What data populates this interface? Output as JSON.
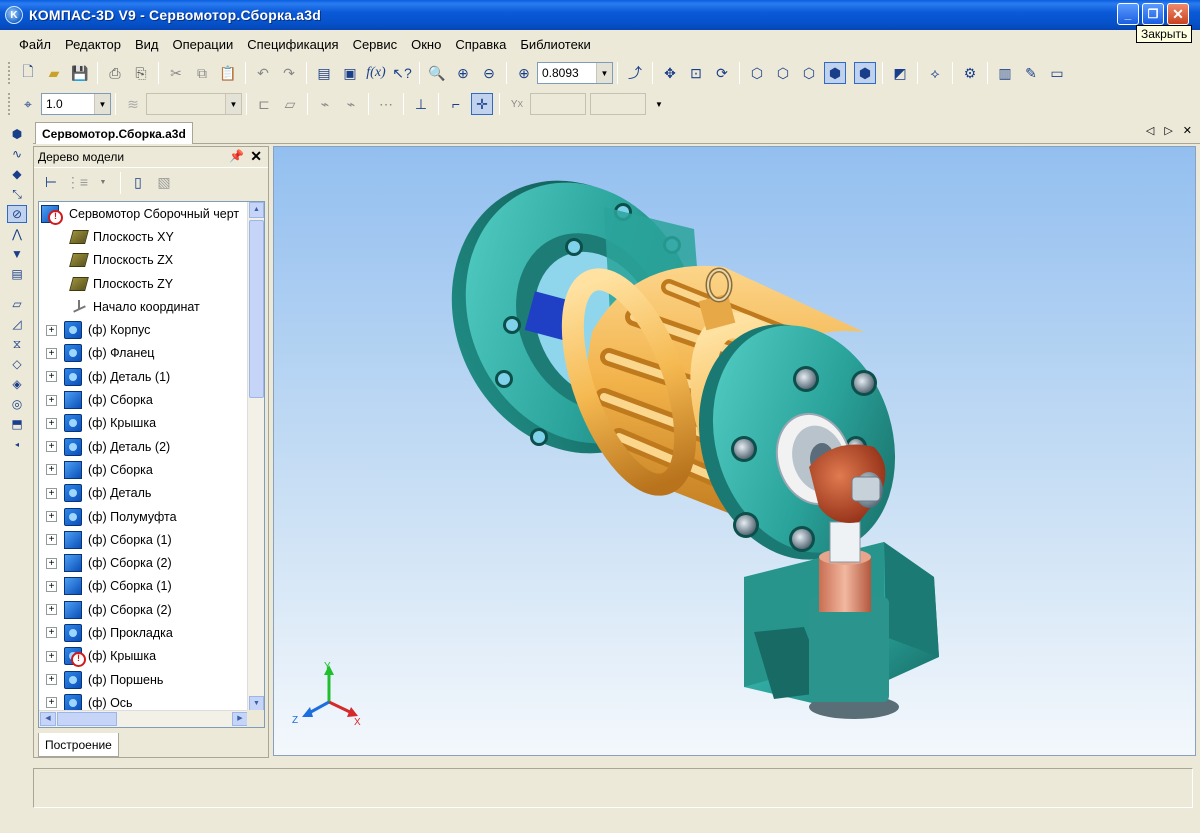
{
  "window": {
    "title": "КОМПАС-3D V9 - Сервомотор.Сборка.a3d",
    "close_tooltip": "Закрыть"
  },
  "menu": [
    "Файл",
    "Редактор",
    "Вид",
    "Операции",
    "Спецификация",
    "Сервис",
    "Окно",
    "Справка",
    "Библиотеки"
  ],
  "toolbar": {
    "zoom_value": "0.8093",
    "step_value": "1.0"
  },
  "document_tab": "Сервомотор.Сборка.a3d",
  "model_tree": {
    "panel_title": "Дерево модели",
    "root": "Сервомотор Сборочный черт",
    "items": [
      {
        "label": "Плоскость XY",
        "type": "plane",
        "expandable": false
      },
      {
        "label": "Плоскость ZX",
        "type": "plane",
        "expandable": false
      },
      {
        "label": "Плоскость ZY",
        "type": "plane",
        "expandable": false
      },
      {
        "label": "Начало координат",
        "type": "origin",
        "expandable": false
      },
      {
        "label": "(ф) Корпус",
        "type": "part",
        "expandable": true
      },
      {
        "label": "(ф) Фланец",
        "type": "part",
        "expandable": true
      },
      {
        "label": "(ф) Деталь (1)",
        "type": "part",
        "expandable": true
      },
      {
        "label": "(ф) Сборка",
        "type": "asm",
        "expandable": true
      },
      {
        "label": "(ф) Крышка",
        "type": "part",
        "expandable": true
      },
      {
        "label": "(ф) Деталь (2)",
        "type": "part",
        "expandable": true
      },
      {
        "label": "(ф) Сборка",
        "type": "asm",
        "expandable": true
      },
      {
        "label": "(ф) Деталь",
        "type": "part",
        "expandable": true
      },
      {
        "label": "(ф) Полумуфта",
        "type": "part",
        "expandable": true
      },
      {
        "label": "(ф) Сборка (1)",
        "type": "asm",
        "expandable": true
      },
      {
        "label": "(ф) Сборка (2)",
        "type": "asm",
        "expandable": true
      },
      {
        "label": "(ф) Сборка (1)",
        "type": "asm",
        "expandable": true
      },
      {
        "label": "(ф) Сборка (2)",
        "type": "asm",
        "expandable": true
      },
      {
        "label": "(ф) Прокладка",
        "type": "part",
        "expandable": true
      },
      {
        "label": "(ф) Крышка",
        "type": "part-error",
        "expandable": true
      },
      {
        "label": "(ф) Поршень",
        "type": "part",
        "expandable": true
      },
      {
        "label": "(ф) Ось",
        "type": "part",
        "expandable": true
      }
    ],
    "bottom_tab": "Построение"
  },
  "axes": {
    "x": "X",
    "y": "Y",
    "z": "Z"
  },
  "colors": {
    "teal_body": "#2FA39C",
    "orange_cylinder": "#F2B24A",
    "viewport_top": "#93BFF0",
    "viewport_bottom": "#F4F8FC"
  }
}
